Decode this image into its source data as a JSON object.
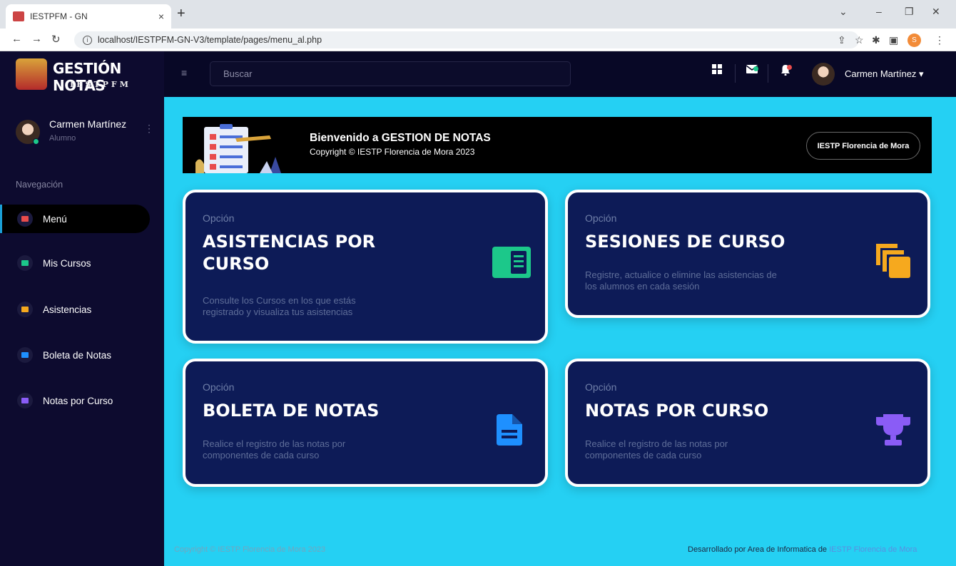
{
  "browser": {
    "tab_title": "IESTPFM - GN",
    "tab_close": "×",
    "new_tab": "+",
    "url": "localhost/IESTPFM-GN-V3/template/pages/menu_al.php",
    "profile_initial": "S"
  },
  "header": {
    "brand_title": "GESTIÓN NOTAS",
    "brand_subtitle": "IESTPFM",
    "search_placeholder": "Buscar",
    "user_name": "Carmen Martínez"
  },
  "sidebar": {
    "user_name": "Carmen Martínez",
    "user_role": "Alumno",
    "section_label": "Navegación",
    "items": [
      {
        "label": "Menú",
        "color": "#e84c4c"
      },
      {
        "label": "Mis Cursos",
        "color": "#1cc88a"
      },
      {
        "label": "Asistencias",
        "color": "#f6a91e"
      },
      {
        "label": "Boleta de Notas",
        "color": "#1e90ff"
      },
      {
        "label": "Notas por Curso",
        "color": "#8a5cf6"
      }
    ]
  },
  "banner": {
    "title": "Bienvenido a GESTION DE NOTAS",
    "copyright": "Copyright © IESTP Florencia de Mora 2023",
    "button": "IESTP Florencia de Mora"
  },
  "cards": [
    {
      "kicker": "Opción",
      "title_line1": "ASISTENCIAS POR",
      "title_line2": "CURSO",
      "desc_line1": "Consulte los Cursos en los que estás",
      "desc_line2": "registrado y visualiza tus asistencias",
      "icon": "id-card-icon",
      "color": "#1cc88a"
    },
    {
      "kicker": "Opción",
      "title_line1": "SESIONES DE CURSO",
      "title_line2": "",
      "desc_line1": "Registre, actualice o elimine las asistencias de",
      "desc_line2": "los alumnos en cada sesión",
      "icon": "copy-icon",
      "color": "#f6a91e"
    },
    {
      "kicker": "Opción",
      "title_line1": "BOLETA DE NOTAS",
      "title_line2": "",
      "desc_line1": "Realice el registro de las notas por",
      "desc_line2": "componentes de cada curso",
      "icon": "file-icon",
      "color": "#1e90ff"
    },
    {
      "kicker": "Opción",
      "title_line1": "NOTAS POR CURSO",
      "title_line2": "",
      "desc_line1": "Realice el registro de las notas por",
      "desc_line2": "componentes de cada curso",
      "icon": "trophy-icon",
      "color": "#8a5cf6"
    }
  ],
  "footer": {
    "left": "Copyright © IESTP Florencia de Mora 2023",
    "right_prefix": "Desarrollado por Area de Informatica de ",
    "right_link": "IESTP Florencia de Mora"
  }
}
